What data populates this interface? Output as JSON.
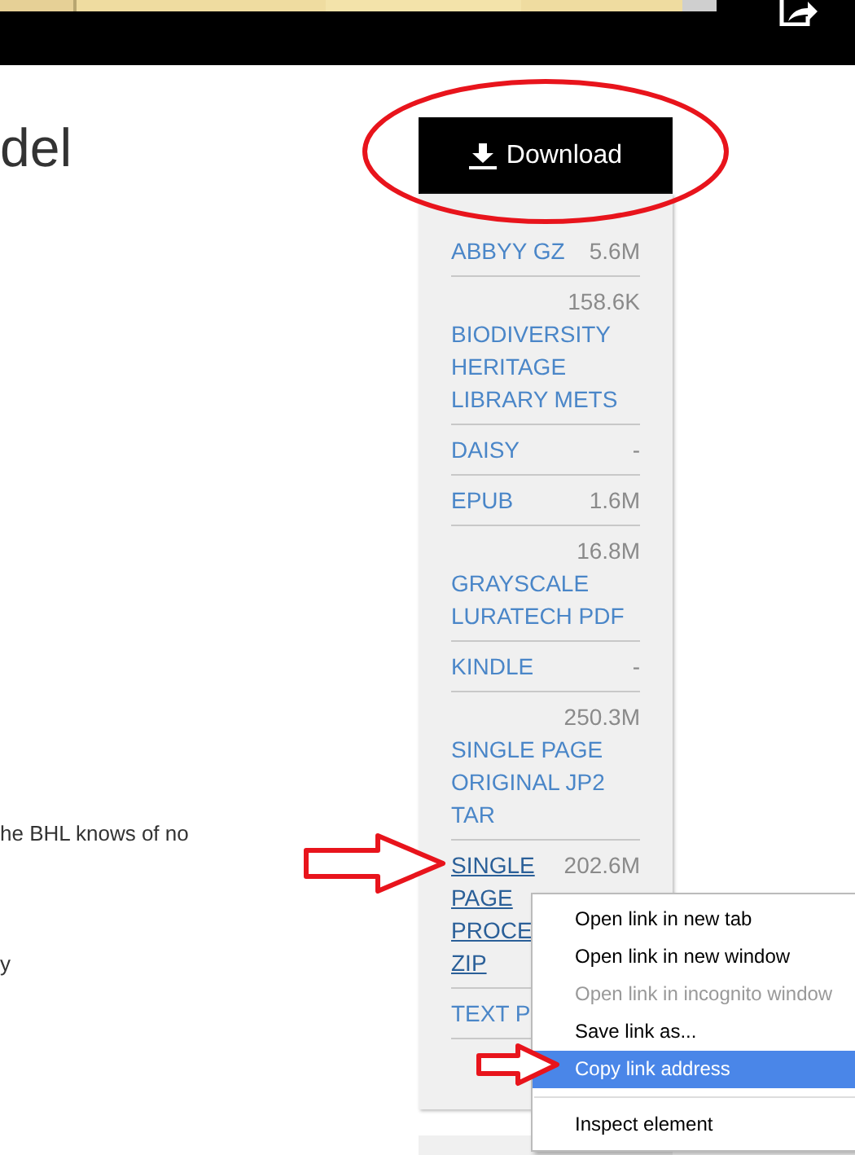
{
  "title": "del",
  "body_texts": [
    "he BHL knows of no",
    "y"
  ],
  "download_button": {
    "label": "Download"
  },
  "files": [
    {
      "name": [
        "ABBYY GZ"
      ],
      "size": "5.6M",
      "hovered": false
    },
    {
      "name": [
        "BIODIVERSITY HERITAGE LIBRARY METS"
      ],
      "size": "158.6K",
      "hovered": false
    },
    {
      "name": [
        "DAISY"
      ],
      "size": "-",
      "hovered": false
    },
    {
      "name": [
        "EPUB"
      ],
      "size": "1.6M",
      "hovered": false
    },
    {
      "name": [
        "GRAYSCALE LURATECH PDF"
      ],
      "size": "16.8M",
      "hovered": false
    },
    {
      "name": [
        "KINDLE"
      ],
      "size": "-",
      "hovered": false
    },
    {
      "name": [
        "SINGLE PAGE ORIGINAL JP2 TAR"
      ],
      "size": "250.3M",
      "hovered": false
    },
    {
      "name": [
        "SINGLE",
        "PAGE",
        "PROCE",
        "ZIP"
      ],
      "size": "202.6M",
      "hovered": true
    },
    {
      "name": [
        "TEXT P"
      ],
      "hovered": false
    }
  ],
  "context_menu": [
    {
      "kind": "item",
      "label": "Open link in new tab",
      "disabled": false,
      "selected": false
    },
    {
      "kind": "item",
      "label": "Open link in new window",
      "disabled": false,
      "selected": false
    },
    {
      "kind": "item",
      "label": "Open link in incognito window",
      "disabled": true,
      "selected": false
    },
    {
      "kind": "item",
      "label": "Save link as...",
      "disabled": false,
      "selected": false
    },
    {
      "kind": "item",
      "label": "Copy link address",
      "disabled": false,
      "selected": true
    },
    {
      "kind": "separator"
    },
    {
      "kind": "item",
      "label": "Inspect element",
      "disabled": false,
      "selected": false
    }
  ]
}
